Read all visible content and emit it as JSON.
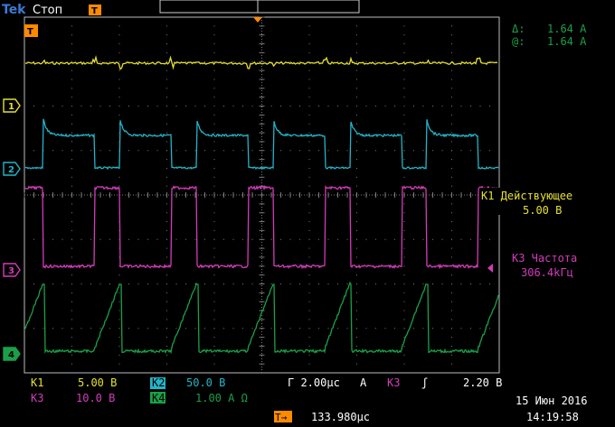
{
  "header": {
    "brand": "Tek",
    "status": "Стоп",
    "trigger_marker": "T"
  },
  "cursor_readout": {
    "delta_symbol": "Δ:",
    "delta_value": "1.64 A",
    "at_symbol": "@:",
    "at_value": "1.64 A"
  },
  "measurements": {
    "m1_title": "K1 Действующее",
    "m1_value": "5.00 B",
    "m2_title": "K3 Частота",
    "m2_value": "306.4kГц"
  },
  "channel_markers": {
    "ch1": "1",
    "ch2": "2",
    "ch3": "3",
    "ch4": "4",
    "trigger_left": "T"
  },
  "bottom": {
    "k1_label": "K1",
    "k1_value": "5.00 B",
    "k2_label": "K2",
    "k2_value": "50.0 B",
    "timebase": "Г 2.00µc",
    "trig_mode": "A",
    "trig_src": "K3",
    "trig_slope": "ʃ",
    "trig_level": "2.20 B",
    "k3_label": "K3",
    "k3_value": "10.0 B",
    "k4_label": "K4",
    "k4_value": "1.00 A Ω",
    "delay_marker": "T→",
    "delay": "133.980µc",
    "date": "15 Июн 2016",
    "time": "14:19:58"
  },
  "colors": {
    "ch1": "#e6e030",
    "ch2": "#22b5c8",
    "ch3": "#d23cb8",
    "ch4": "#1aa048",
    "trigger": "#ff8a00",
    "grid": "#7a7a7a"
  }
}
